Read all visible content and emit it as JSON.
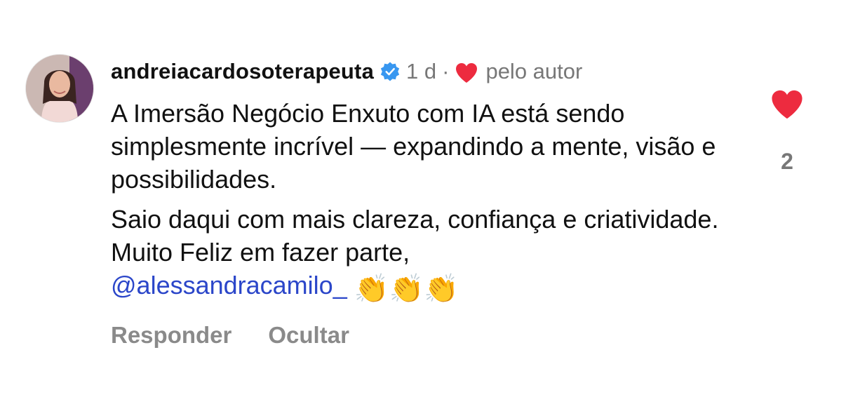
{
  "comment": {
    "username": "andreiacardosoterapeuta",
    "time": "1 d",
    "separator": "·",
    "liked_by_author_label": "pelo autor",
    "paragraph1": "A Imersão Negócio Enxuto com IA está sendo simplesmente incrível — expandindo a mente, visão e possibilidades.",
    "paragraph2": "Saio daqui com mais clareza, confiança e criatividade. Muito Feliz em fazer parte,",
    "mention": "@alessandracamilo_",
    "emoji": "👏👏👏",
    "like_count": "2"
  },
  "actions": {
    "reply_label": "Responder",
    "hide_label": "Ocultar"
  },
  "icons": {
    "verified": "verified-badge-icon",
    "author_heart": "heart-icon",
    "like": "heart-icon"
  },
  "colors": {
    "heart": "#ED2B3F",
    "verified": "#3897F0",
    "mention": "#2B46C9",
    "muted": "#8A8A8A"
  }
}
